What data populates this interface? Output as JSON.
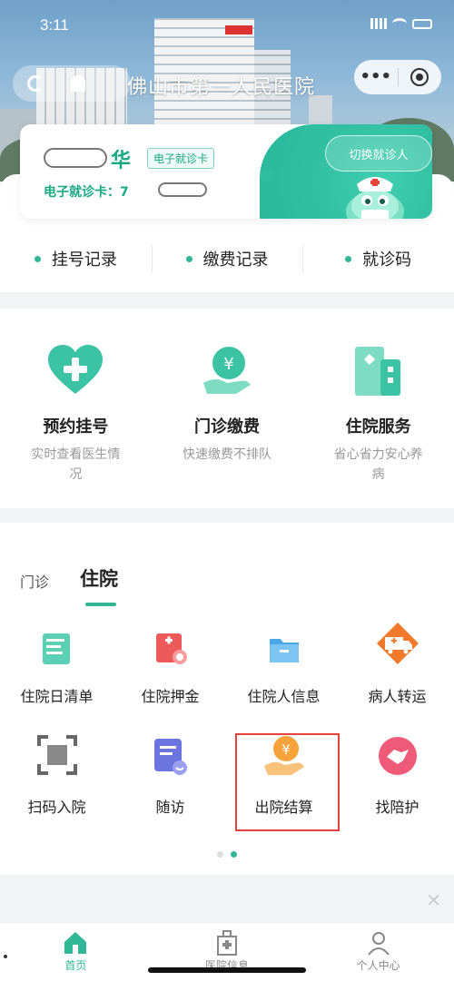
{
  "status_bar": {
    "time": "3:11"
  },
  "nav": {
    "title": "佛山市第一人民医院"
  },
  "card": {
    "name_suffix": "华",
    "tag": "电子就诊卡",
    "number_label": "电子就诊卡：7",
    "switch_label": "切换就诊人"
  },
  "quick_links": [
    {
      "label": "挂号记录"
    },
    {
      "label": "缴费记录"
    },
    {
      "label": "就诊码"
    }
  ],
  "services": [
    {
      "title": "预约挂号",
      "desc": "实时查看医生情况",
      "icon": "heart-plus-icon"
    },
    {
      "title": "门诊缴费",
      "desc": "快速缴费不排队",
      "icon": "yuan-hand-icon"
    },
    {
      "title": "住院服务",
      "desc": "省心省力安心养病",
      "icon": "hospital-building-icon"
    }
  ],
  "tabs": [
    {
      "label": "门诊",
      "active": false
    },
    {
      "label": "住院",
      "active": true
    }
  ],
  "grid": [
    {
      "label": "住院日清单",
      "icon": "daily-list-icon"
    },
    {
      "label": "住院押金",
      "icon": "deposit-icon"
    },
    {
      "label": "住院人信息",
      "icon": "patient-folder-icon"
    },
    {
      "label": "病人转运",
      "icon": "ambulance-icon"
    },
    {
      "label": "扫码入院",
      "icon": "scan-icon"
    },
    {
      "label": "随访",
      "icon": "followup-icon"
    },
    {
      "label": "出院结算",
      "icon": "yuan-hand-icon"
    },
    {
      "label": "找陪护",
      "icon": "handshake-icon"
    }
  ],
  "tabbar": [
    {
      "label": "首页",
      "active": true
    },
    {
      "label": "医院信息",
      "active": false
    },
    {
      "label": "个人中心",
      "active": false
    }
  ],
  "colors": {
    "accent": "#2fb796",
    "highlight": "#e4433d"
  }
}
